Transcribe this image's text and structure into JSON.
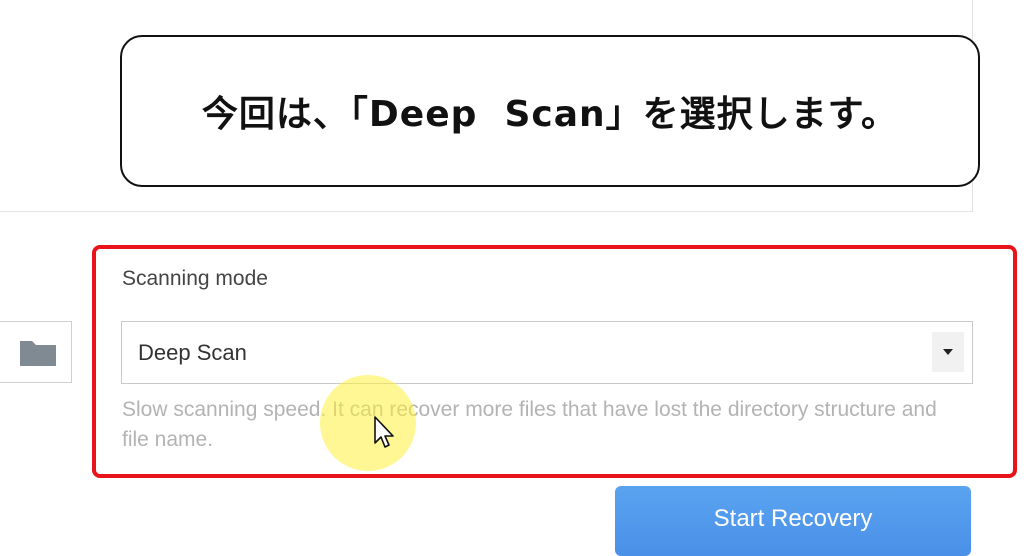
{
  "caption": {
    "text": "今回は、「Deep  Scan」を選択します。"
  },
  "scan_settings": {
    "mode_label": "Scanning mode",
    "selected_mode": "Deep Scan",
    "description": "Slow scanning speed. It can recover more files that have lost the directory structure and file name."
  },
  "actions": {
    "start_label": "Start Recovery"
  },
  "colors": {
    "highlight_frame": "#e8141a",
    "primary_button": "#4a90e8",
    "click_highlight": "#fff03c"
  },
  "icons": {
    "folder": "folder-icon",
    "dropdown": "caret-down-icon",
    "cursor": "mouse-pointer-icon"
  }
}
